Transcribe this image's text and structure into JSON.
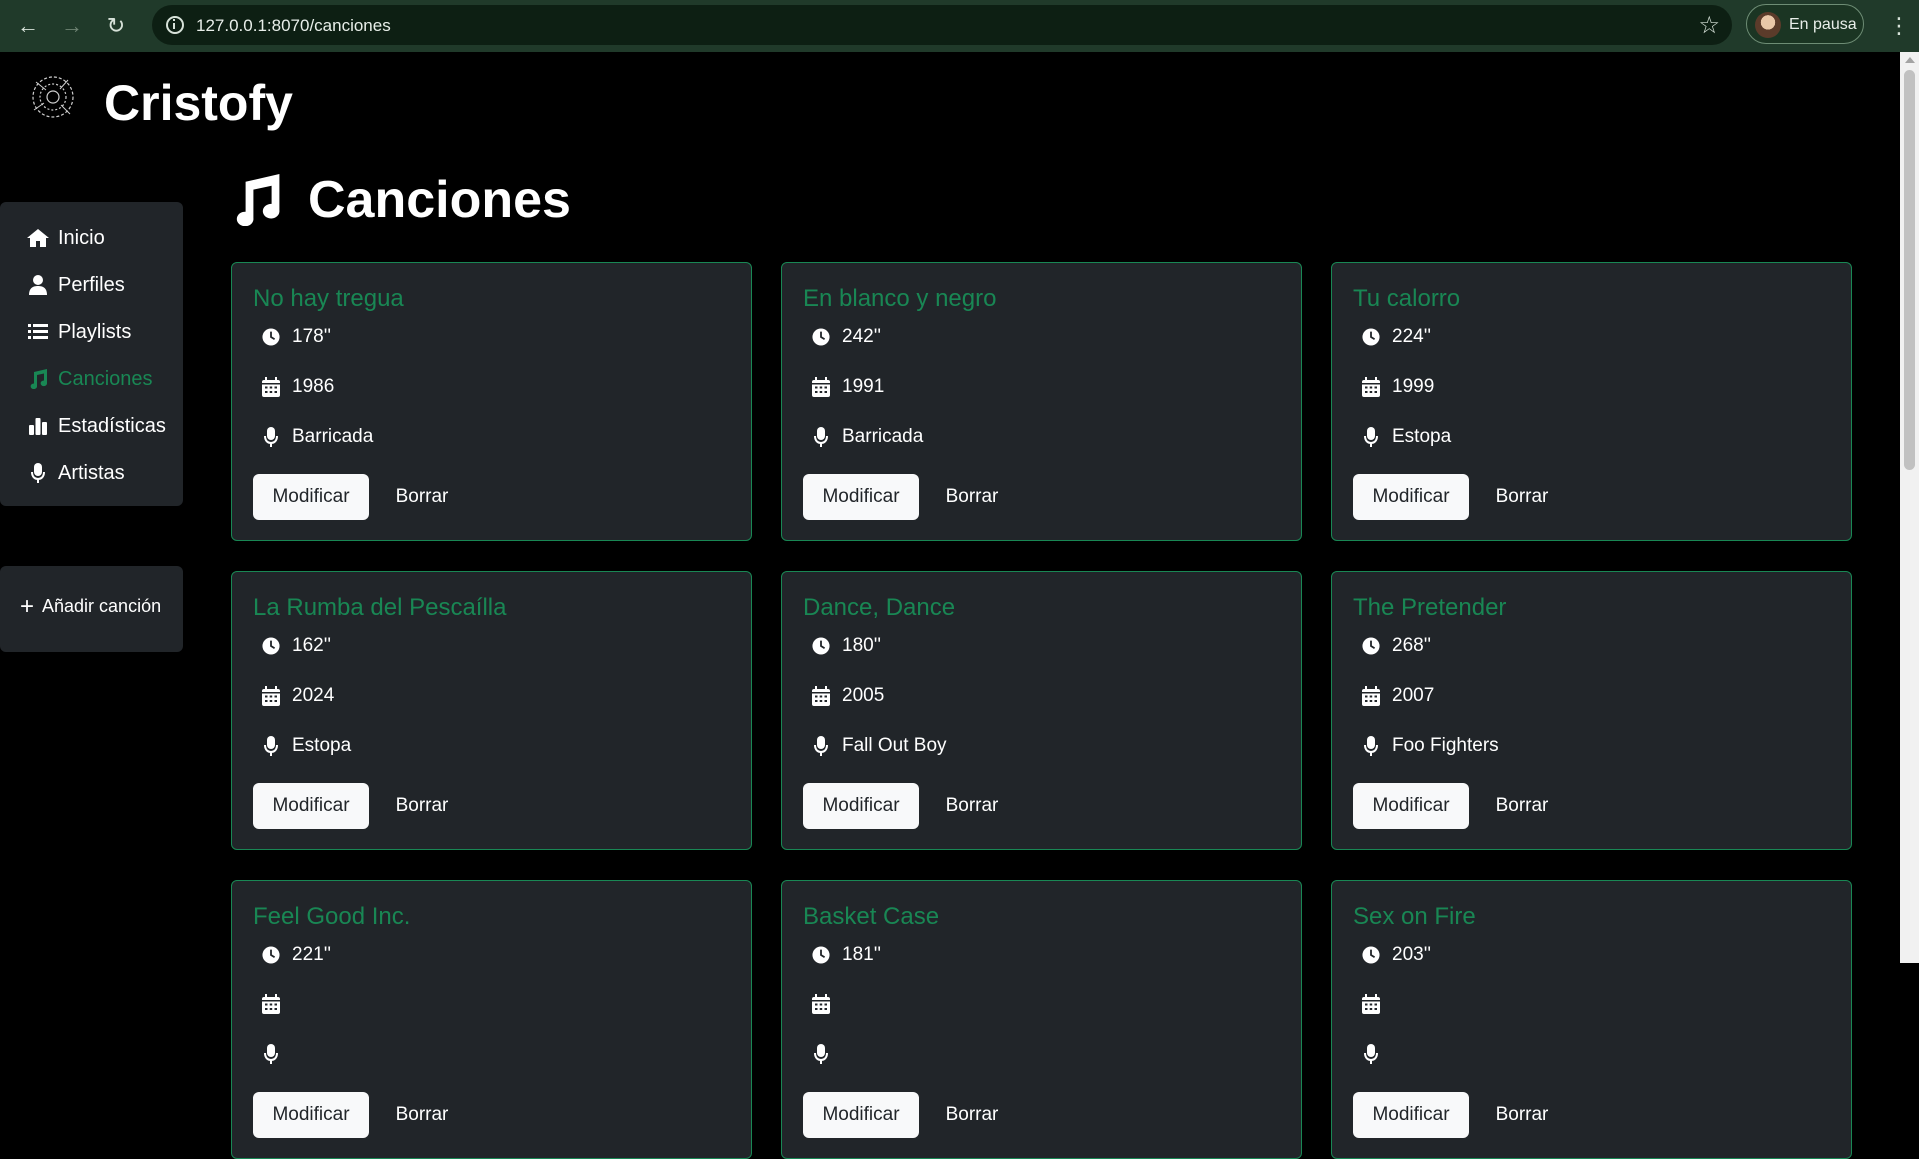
{
  "browser": {
    "url": "127.0.0.1:8070/canciones",
    "profile_label": "En pausa"
  },
  "app": {
    "brand": "Cristofy"
  },
  "sidebar": {
    "items": [
      {
        "label": "Inicio",
        "icon": "home-icon"
      },
      {
        "label": "Perfiles",
        "icon": "user-icon"
      },
      {
        "label": "Playlists",
        "icon": "list-icon"
      },
      {
        "label": "Canciones",
        "icon": "music-icon",
        "active": true
      },
      {
        "label": "Estadísticas",
        "icon": "chart-icon"
      },
      {
        "label": "Artistas",
        "icon": "microphone-icon"
      }
    ],
    "add_label": "Añadir canción"
  },
  "main": {
    "title": "Canciones",
    "modify_label": "Modificar",
    "delete_label": "Borrar",
    "songs": [
      {
        "title": "No hay tregua",
        "duration": "178''",
        "year": "1986",
        "artist": "Barricada"
      },
      {
        "title": "En blanco y negro",
        "duration": "242''",
        "year": "1991",
        "artist": "Barricada"
      },
      {
        "title": "Tu calorro",
        "duration": "224''",
        "year": "1999",
        "artist": "Estopa"
      },
      {
        "title": "La Rumba del Pescaílla",
        "duration": "162''",
        "year": "2024",
        "artist": "Estopa"
      },
      {
        "title": "Dance, Dance",
        "duration": "180''",
        "year": "2005",
        "artist": "Fall Out Boy"
      },
      {
        "title": "The Pretender",
        "duration": "268''",
        "year": "2007",
        "artist": "Foo Fighters"
      },
      {
        "title": "Feel Good Inc.",
        "duration": "221''",
        "year": "",
        "artist": ""
      },
      {
        "title": "Basket Case",
        "duration": "181''",
        "year": "",
        "artist": ""
      },
      {
        "title": "Sex on Fire",
        "duration": "203''",
        "year": "",
        "artist": ""
      }
    ]
  },
  "colors": {
    "accent": "#198754",
    "card_bg": "#212529",
    "page_bg": "#000000",
    "browser_bar": "#203a2a"
  }
}
